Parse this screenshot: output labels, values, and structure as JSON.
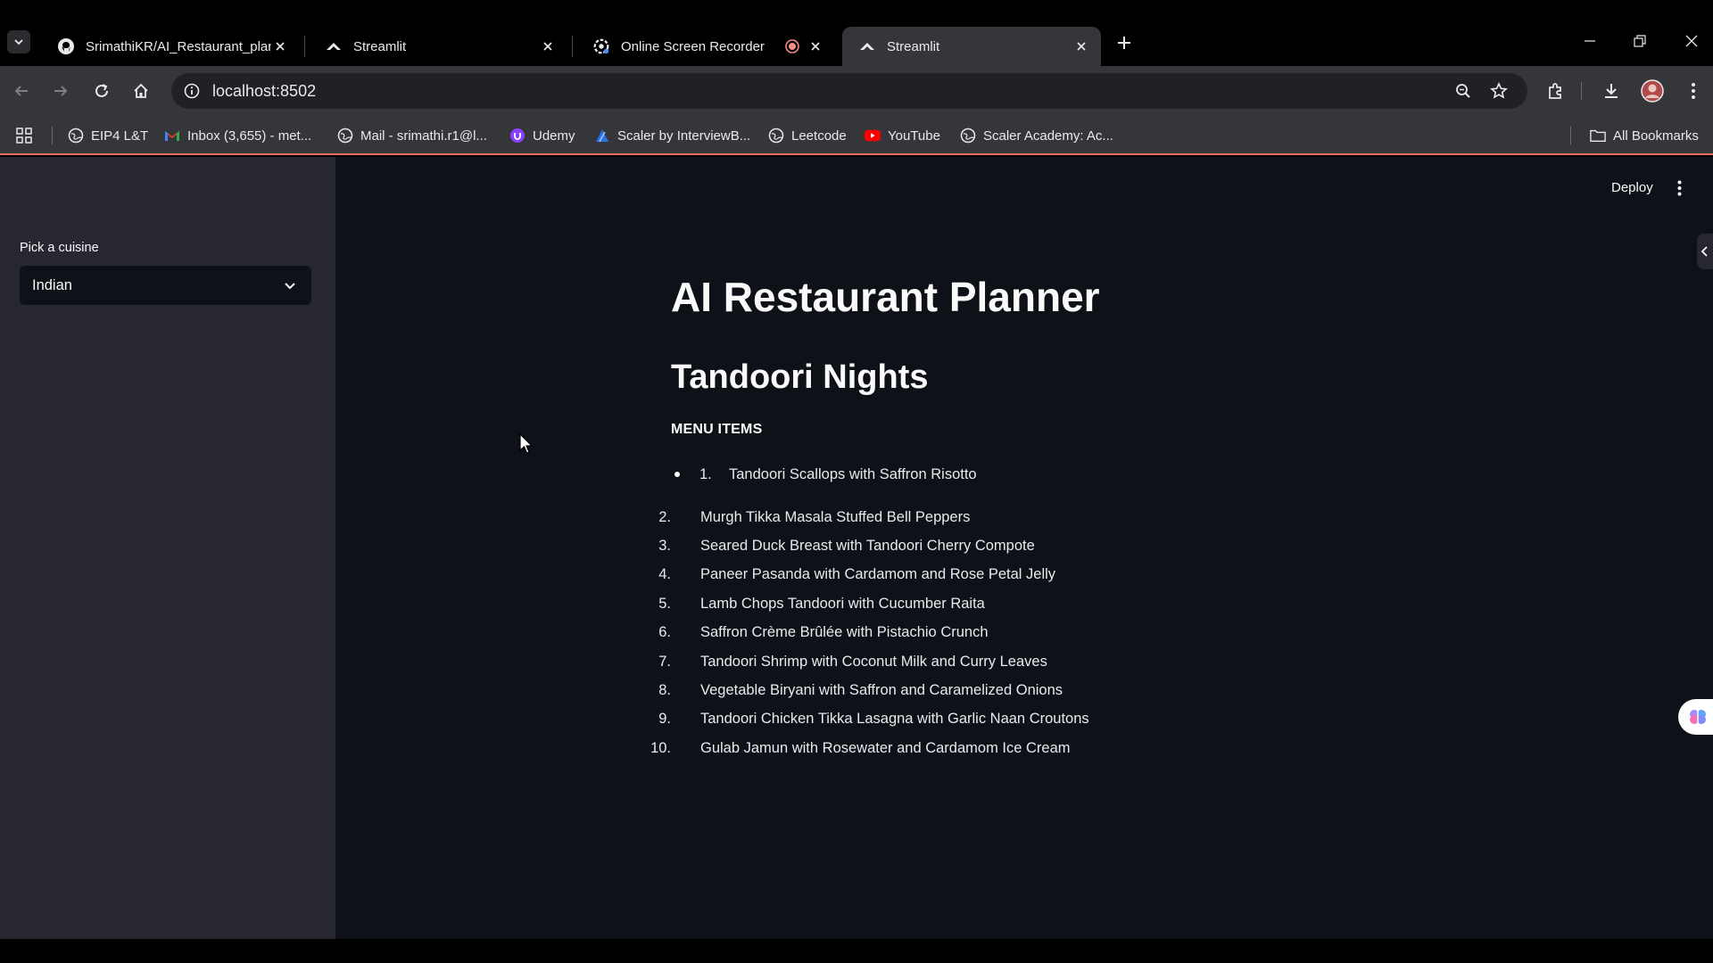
{
  "browser": {
    "tabs": [
      {
        "title": "SrimathiKR/AI_Restaurant_plann",
        "favicon": "github-icon",
        "active": false
      },
      {
        "title": "Streamlit",
        "favicon": "streamlit-icon",
        "active": false
      },
      {
        "title": "Online Screen Recorder",
        "favicon": "recorder-icon",
        "active": false
      },
      {
        "title": "Streamlit",
        "favicon": "streamlit-icon",
        "active": true
      }
    ],
    "url": "localhost:8502",
    "bookmarks": [
      {
        "label": "EIP4 L&T",
        "icon": "globe-icon"
      },
      {
        "label": "Inbox (3,655) - met...",
        "icon": "gmail-icon"
      },
      {
        "label": "Mail - srimathi.r1@l...",
        "icon": "globe-icon"
      },
      {
        "label": "Udemy",
        "icon": "udemy-icon"
      },
      {
        "label": "Scaler by InterviewB...",
        "icon": "scaler-icon"
      },
      {
        "label": "Leetcode",
        "icon": "globe-icon"
      },
      {
        "label": "YouTube",
        "icon": "youtube-icon"
      },
      {
        "label": "Scaler Academy: Ac...",
        "icon": "globe-icon"
      }
    ],
    "all_bookmarks": "All Bookmarks"
  },
  "sidebar": {
    "label": "Pick a cuisine",
    "selected": "Indian"
  },
  "header": {
    "deploy": "Deploy"
  },
  "main": {
    "title": "AI Restaurant Planner",
    "restaurant_name": "Tandoori Nights",
    "menu_heading": "MENU ITEMS",
    "first_item": {
      "number": "1.",
      "text": "Tandoori Scallops with Saffron Risotto"
    },
    "items": [
      {
        "number": "2.",
        "text": "Murgh Tikka Masala Stuffed Bell Peppers"
      },
      {
        "number": "3.",
        "text": "Seared Duck Breast with Tandoori Cherry Compote"
      },
      {
        "number": "4.",
        "text": "Paneer Pasanda with Cardamom and Rose Petal Jelly"
      },
      {
        "number": "5.",
        "text": "Lamb Chops Tandoori with Cucumber Raita"
      },
      {
        "number": "6.",
        "text": "Saffron Crème Brûlée with Pistachio Crunch"
      },
      {
        "number": "7.",
        "text": "Tandoori Shrimp with Coconut Milk and Curry Leaves"
      },
      {
        "number": "8.",
        "text": "Vegetable Biryani with Saffron and Caramelized Onions"
      },
      {
        "number": "9.",
        "text": "Tandoori Chicken Tikka Lasagna with Garlic Naan Croutons"
      },
      {
        "number": "10.",
        "text": "Gulab Jamun with Rosewater and Cardamom Ice Cream"
      }
    ]
  },
  "colors": {
    "sidebar_bg": "#262730",
    "main_bg": "#0e1117",
    "chrome_bg": "#35363a",
    "accent_line": "#e8705a"
  }
}
